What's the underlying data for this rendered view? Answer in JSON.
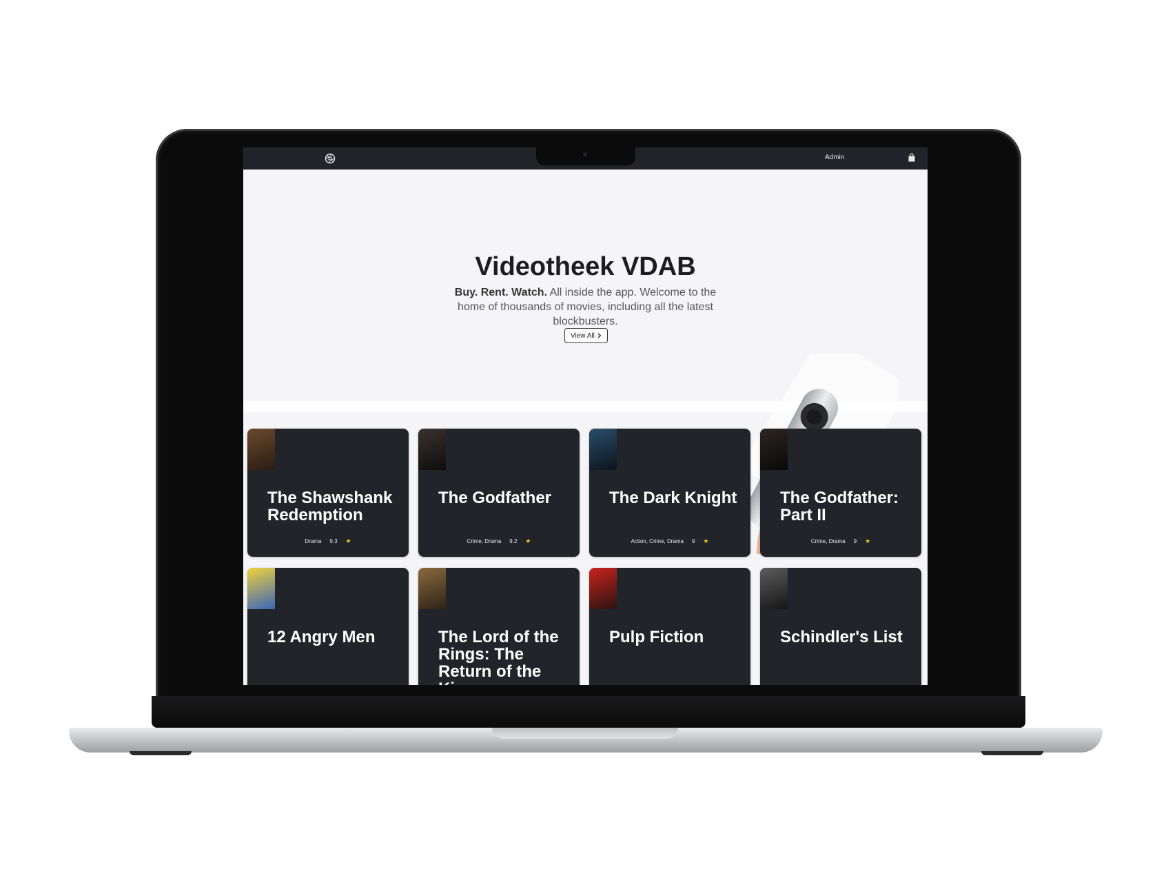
{
  "navbar": {
    "admin_label": "Admin",
    "logo_icon": "aperture-icon",
    "cart_icon": "shopping-bag-icon"
  },
  "hero": {
    "title": "Videotheek VDAB",
    "tagline_bold": "Buy. Rent. Watch.",
    "tagline_rest": " All inside the app. Welcome to the home of thousands of movies, including all the latest blockbusters.",
    "button_label": "View All",
    "button_icon": "chevron-right-icon"
  },
  "colors": {
    "navbar": "#212529",
    "card": "#212529",
    "hero_bg": "#f5f5f7",
    "star": "#f5c518"
  },
  "movies": [
    {
      "title": "The Shawshank Redemption",
      "genres": "Drama",
      "rating": "9.3",
      "poster": [
        "#6b4a2e",
        "#2a1c12"
      ]
    },
    {
      "title": "The Godfather",
      "genres": "Crime, Drama",
      "rating": "9.2",
      "poster": [
        "#3a3330",
        "#0f0d0c"
      ]
    },
    {
      "title": "The Dark Knight",
      "genres": "Action, Crime, Drama",
      "rating": "9",
      "poster": [
        "#2b4e6a",
        "#0b141d"
      ]
    },
    {
      "title": "The Godfather: Part II",
      "genres": "Crime, Drama",
      "rating": "9",
      "poster": [
        "#2c2622",
        "#0a0908"
      ]
    },
    {
      "title": "12 Angry Men",
      "genres": "",
      "rating": "",
      "poster": [
        "#f1d23a",
        "#3a66b8"
      ]
    },
    {
      "title": "The Lord of the Rings: The Return of the King",
      "genres": "",
      "rating": "",
      "poster": [
        "#8a6a3d",
        "#2d2417"
      ]
    },
    {
      "title": "Pulp Fiction",
      "genres": "",
      "rating": "",
      "poster": [
        "#c8231e",
        "#2b1410"
      ]
    },
    {
      "title": "Schindler's List",
      "genres": "",
      "rating": "",
      "poster": [
        "#5c5c5c",
        "#161616"
      ]
    }
  ]
}
